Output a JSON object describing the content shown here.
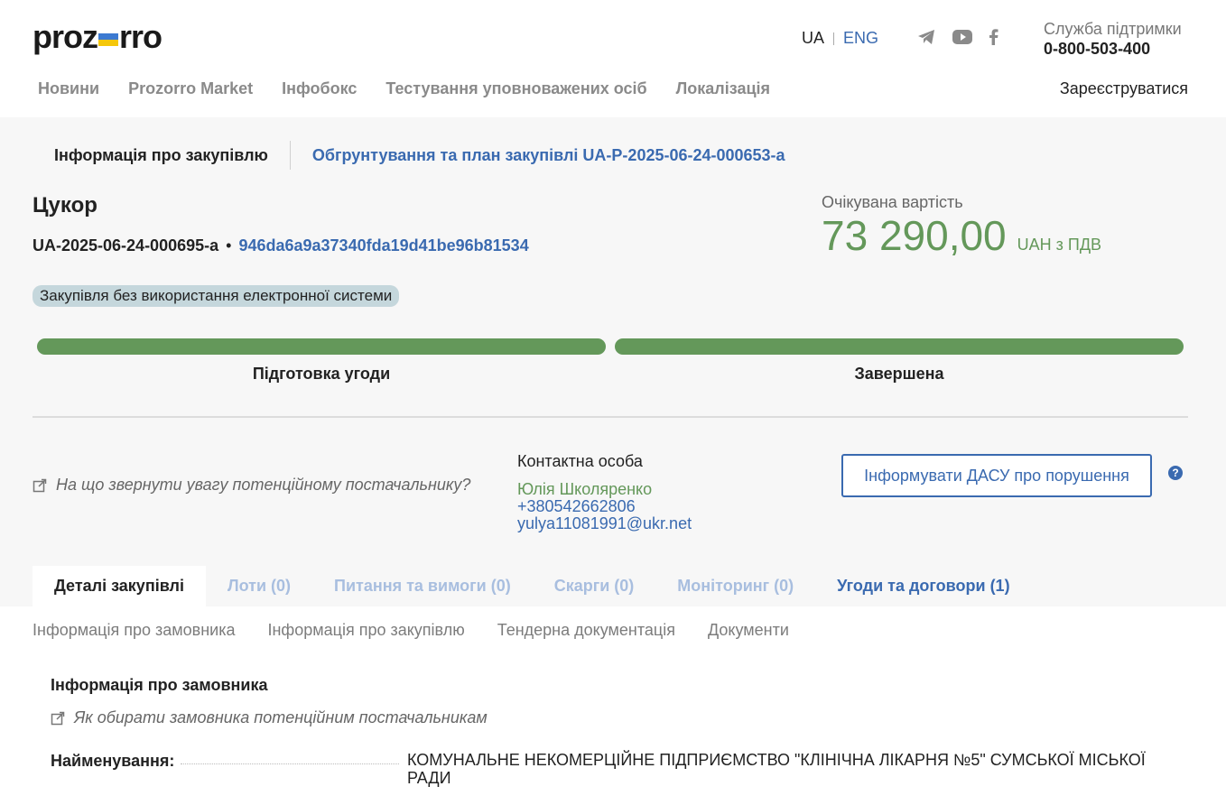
{
  "header": {
    "logo_left": "proz",
    "logo_right": "rro",
    "lang_ua": "UA",
    "lang_eng": "ENG",
    "support_label": "Служба підтримки",
    "support_phone": "0-800-503-400",
    "nav": [
      "Новини",
      "Prozorro Market",
      "Інфобокс",
      "Тестування уповноважених осіб",
      "Локалізація"
    ],
    "register": "Зареєструватися",
    "flag_colors": {
      "top": "#3c7ad1",
      "bottom": "#f5c70a"
    }
  },
  "crumbs": {
    "current": "Інформація про закупівлю",
    "link": "Обгрунтування та план закупівлі UA-P-2025-06-24-000653-a"
  },
  "tender": {
    "title": "Цукор",
    "id": "UA-2025-06-24-000695-a",
    "dot": "•",
    "hash": "946da6a9a37340fda19d41be96b81534",
    "badge": "Закупівля без використання електронної системи",
    "value_label": "Очікувана вартість",
    "value": "73 290,00",
    "currency": "UAH з ПДВ"
  },
  "progress": {
    "stages": [
      {
        "label": "Підготовка угоди",
        "fill": 1.0
      },
      {
        "label": "Завершена",
        "fill": 1.0
      }
    ],
    "color": "#64985a"
  },
  "supplier_hint": "На що звернути увагу потенційному постачальнику?",
  "contact": {
    "heading": "Контактна особа",
    "name": "Юлія Школяренко",
    "phone": "+380542662806",
    "email": "yulya11081991@ukr.net"
  },
  "dasu_button": "Інформувати ДАСУ про порушення",
  "help_glyph": "?",
  "tabs": [
    {
      "label": "Деталі закупівлі",
      "state": "active"
    },
    {
      "label": "Лоти (0)",
      "state": "disabled"
    },
    {
      "label": "Питання та вимоги (0)",
      "state": "disabled"
    },
    {
      "label": "Скарги (0)",
      "state": "disabled"
    },
    {
      "label": "Моніторинг (0)",
      "state": "disabled"
    },
    {
      "label": "Угоди та договори (1)",
      "state": "link"
    }
  ],
  "subtabs": [
    "Інформація про замовника",
    "Інформація про закупівлю",
    "Тендерна документація",
    "Документи"
  ],
  "customer": {
    "title": "Інформація про замовника",
    "hint": "Як обирати замовника потенційним постачальникам",
    "name_label": "Найменування:",
    "name_value": "КОМУНАЛЬНЕ НЕКОМЕРЦІЙНЕ ПІДПРИЄМСТВО \"КЛІНІЧНА ЛІКАРНЯ №5\" СУМСЬКОЇ МІСЬКОЇ РАДИ"
  },
  "icons": {
    "social": [
      "telegram-icon",
      "youtube-icon",
      "facebook-icon"
    ],
    "external": "external-link-icon"
  }
}
